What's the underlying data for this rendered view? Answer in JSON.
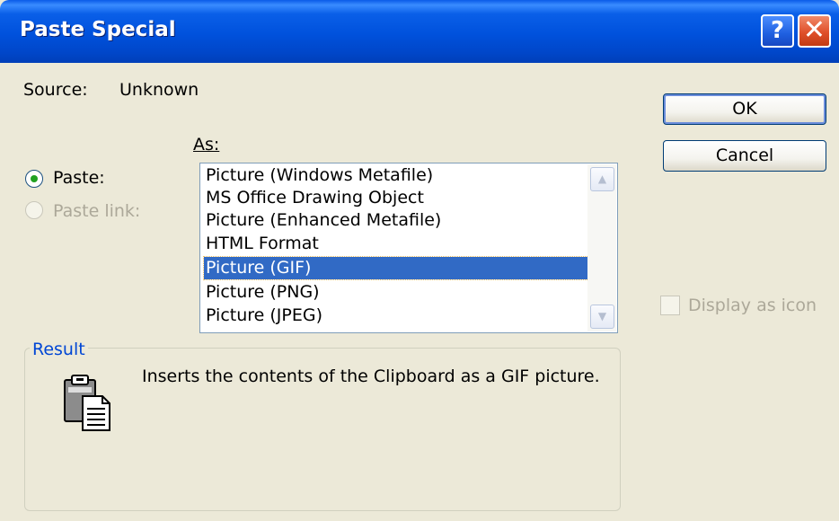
{
  "window": {
    "title": "Paste Special"
  },
  "titlebar_buttons": {
    "help": "?",
    "close": "✕"
  },
  "source": {
    "label": "Source:",
    "value": "Unknown"
  },
  "as_label": "As:",
  "options": {
    "paste": "Paste:",
    "paste_link": "Paste link:",
    "selected": "Paste"
  },
  "formats": [
    "Picture (Windows Metafile)",
    "MS Office Drawing Object",
    "Picture (Enhanced Metafile)",
    "HTML Format",
    "Picture (GIF)",
    "Picture (PNG)",
    "Picture (JPEG)"
  ],
  "selected_format": "Picture (GIF)",
  "scroll_arrows": {
    "up": "▲",
    "down": "▼"
  },
  "buttons": {
    "ok": "OK",
    "cancel": "Cancel"
  },
  "display_as_icon": {
    "label": "Display as icon",
    "checked": false,
    "enabled": false
  },
  "result": {
    "legend": "Result",
    "text": "Inserts the contents of the Clipboard as a GIF picture.",
    "icon": "clipboard-paste-icon"
  }
}
